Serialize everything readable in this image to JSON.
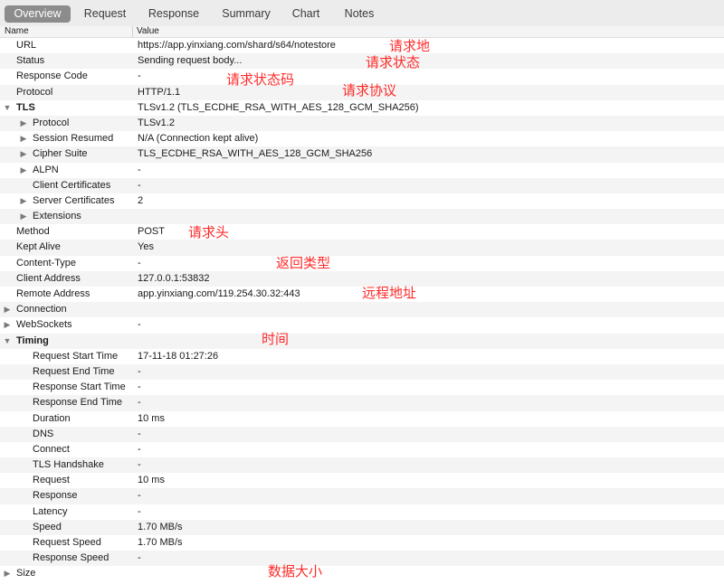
{
  "tabs": [
    "Overview",
    "Request",
    "Response",
    "Summary",
    "Chart",
    "Notes"
  ],
  "columns": {
    "name": "Name",
    "value": "Value"
  },
  "rows": [
    {
      "name": "URL",
      "value": "https://app.yinxiang.com/shard/s64/notestore",
      "level": 0
    },
    {
      "name": "Status",
      "value": "Sending request body...",
      "level": 0
    },
    {
      "name": "Response Code",
      "value": "-",
      "level": 0
    },
    {
      "name": "Protocol",
      "value": "HTTP/1.1",
      "level": 0
    },
    {
      "name": "TLS",
      "value": "TLSv1.2 (TLS_ECDHE_RSA_WITH_AES_128_GCM_SHA256)",
      "level": 0,
      "toggle": "expanded",
      "bold": true
    },
    {
      "name": "Protocol",
      "value": "TLSv1.2",
      "level": 1,
      "toggle": "collapsed"
    },
    {
      "name": "Session Resumed",
      "value": "N/A (Connection kept alive)",
      "level": 1,
      "toggle": "collapsed"
    },
    {
      "name": "Cipher Suite",
      "value": "TLS_ECDHE_RSA_WITH_AES_128_GCM_SHA256",
      "level": 1,
      "toggle": "collapsed"
    },
    {
      "name": "ALPN",
      "value": "-",
      "level": 1,
      "toggle": "collapsed"
    },
    {
      "name": "Client Certificates",
      "value": "-",
      "level": 1
    },
    {
      "name": "Server Certificates",
      "value": "2",
      "level": 1,
      "toggle": "collapsed"
    },
    {
      "name": "Extensions",
      "value": "",
      "level": 1,
      "toggle": "collapsed"
    },
    {
      "name": "Method",
      "value": "POST",
      "level": 0
    },
    {
      "name": "Kept Alive",
      "value": "Yes",
      "level": 0
    },
    {
      "name": "Content-Type",
      "value": "-",
      "level": 0
    },
    {
      "name": "Client Address",
      "value": "127.0.0.1:53832",
      "level": 0
    },
    {
      "name": "Remote Address",
      "value": "app.yinxiang.com/119.254.30.32:443",
      "level": 0
    },
    {
      "name": "Connection",
      "value": "",
      "level": 0,
      "toggle": "collapsed",
      "rootToggle": true
    },
    {
      "name": "WebSockets",
      "value": "-",
      "level": 0,
      "toggle": "collapsed",
      "rootToggle": true
    },
    {
      "name": "Timing",
      "value": "",
      "level": 0,
      "toggle": "expanded",
      "bold": true,
      "rootToggle": true
    },
    {
      "name": "Request Start Time",
      "value": "17-11-18 01:27:26",
      "level": 1
    },
    {
      "name": "Request End Time",
      "value": "-",
      "level": 1
    },
    {
      "name": "Response Start Time",
      "value": "-",
      "level": 1
    },
    {
      "name": "Response End Time",
      "value": "-",
      "level": 1
    },
    {
      "name": "Duration",
      "value": "10 ms",
      "level": 1
    },
    {
      "name": "DNS",
      "value": "-",
      "level": 1
    },
    {
      "name": "Connect",
      "value": "-",
      "level": 1
    },
    {
      "name": "TLS Handshake",
      "value": "-",
      "level": 1
    },
    {
      "name": "Request",
      "value": "10 ms",
      "level": 1
    },
    {
      "name": "Response",
      "value": "-",
      "level": 1
    },
    {
      "name": "Latency",
      "value": "-",
      "level": 1
    },
    {
      "name": "Speed",
      "value": "1.70 MB/s",
      "level": 1
    },
    {
      "name": "Request Speed",
      "value": "1.70 MB/s",
      "level": 1
    },
    {
      "name": "Response Speed",
      "value": "-",
      "level": 1
    },
    {
      "name": "Size",
      "value": "",
      "level": 0,
      "toggle": "collapsed",
      "rootToggle": true
    }
  ],
  "annotations": {
    "url": "请求地",
    "status": "请求状态",
    "response_code": "请求状态码",
    "protocol": "请求协议",
    "method": "请求头",
    "content_type": "返回类型",
    "remote_address": "远程地址",
    "timing": "时间",
    "size": "数据大小"
  },
  "colors": {
    "annotation": "#ff2a2a",
    "active_tab": "#8c8c8c",
    "stripe": "#f4f4f4"
  }
}
